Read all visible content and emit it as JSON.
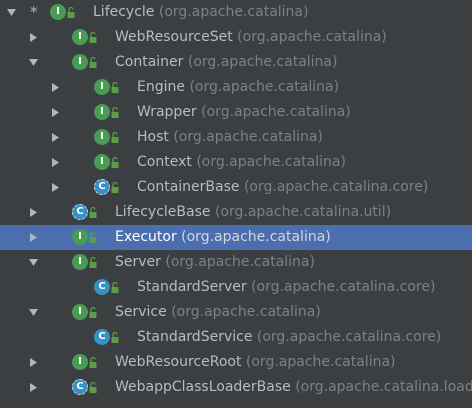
{
  "colors": {
    "background": "#3c3f41",
    "selection": "#4b6eaf",
    "interface_icon": "#499c54",
    "class_icon": "#3592c4",
    "visibility_lock": "#5a9e4a",
    "text": "#bbbbbb",
    "package_text": "#808080"
  },
  "tree": {
    "rows": [
      {
        "name": "Lifecycle",
        "package": "(org.apache.catalina)",
        "kind": "interface",
        "icon_letter": "I",
        "expanded": true,
        "root_marker": "*",
        "selected": false,
        "depth": 0,
        "icon": "interface-icon"
      },
      {
        "name": "WebResourceSet",
        "package": "(org.apache.catalina)",
        "kind": "interface",
        "icon_letter": "I",
        "expanded": false,
        "selected": false,
        "depth": 1,
        "icon": "interface-icon"
      },
      {
        "name": "Container",
        "package": "(org.apache.catalina)",
        "kind": "interface",
        "icon_letter": "I",
        "expanded": true,
        "selected": false,
        "depth": 1,
        "icon": "interface-icon"
      },
      {
        "name": "Engine",
        "package": "(org.apache.catalina)",
        "kind": "interface",
        "icon_letter": "I",
        "expanded": false,
        "selected": false,
        "depth": 2,
        "icon": "interface-icon"
      },
      {
        "name": "Wrapper",
        "package": "(org.apache.catalina)",
        "kind": "interface",
        "icon_letter": "I",
        "expanded": false,
        "selected": false,
        "depth": 2,
        "icon": "interface-icon"
      },
      {
        "name": "Host",
        "package": "(org.apache.catalina)",
        "kind": "interface",
        "icon_letter": "I",
        "expanded": false,
        "selected": false,
        "depth": 2,
        "icon": "interface-icon"
      },
      {
        "name": "Context",
        "package": "(org.apache.catalina)",
        "kind": "interface",
        "icon_letter": "I",
        "expanded": false,
        "selected": false,
        "depth": 2,
        "icon": "interface-icon"
      },
      {
        "name": "ContainerBase",
        "package": "(org.apache.catalina.core)",
        "kind": "abstract-class",
        "icon_letter": "C",
        "expanded": false,
        "selected": false,
        "depth": 2,
        "icon": "abstract-class-icon"
      },
      {
        "name": "LifecycleBase",
        "package": "(org.apache.catalina.util)",
        "kind": "abstract-class",
        "icon_letter": "C",
        "expanded": false,
        "selected": false,
        "depth": 1,
        "icon": "abstract-class-icon"
      },
      {
        "name": "Executor",
        "package": "(org.apache.catalina)",
        "kind": "interface",
        "icon_letter": "I",
        "expanded": false,
        "selected": true,
        "depth": 1,
        "icon": "interface-icon"
      },
      {
        "name": "Server",
        "package": "(org.apache.catalina)",
        "kind": "interface",
        "icon_letter": "I",
        "expanded": true,
        "selected": false,
        "depth": 1,
        "icon": "interface-icon"
      },
      {
        "name": "StandardServer",
        "package": "(org.apache.catalina.core)",
        "kind": "class",
        "icon_letter": "C",
        "leaf": true,
        "selected": false,
        "depth": 2,
        "icon": "class-icon"
      },
      {
        "name": "Service",
        "package": "(org.apache.catalina)",
        "kind": "interface",
        "icon_letter": "I",
        "expanded": true,
        "selected": false,
        "depth": 1,
        "icon": "interface-icon"
      },
      {
        "name": "StandardService",
        "package": "(org.apache.catalina.core)",
        "kind": "class",
        "icon_letter": "C",
        "leaf": true,
        "selected": false,
        "depth": 2,
        "icon": "class-icon"
      },
      {
        "name": "WebResourceRoot",
        "package": "(org.apache.catalina)",
        "kind": "interface",
        "icon_letter": "I",
        "expanded": false,
        "selected": false,
        "depth": 1,
        "icon": "interface-icon"
      },
      {
        "name": "WebappClassLoaderBase",
        "package": "(org.apache.catalina.loader)",
        "kind": "abstract-class",
        "icon_letter": "C",
        "expanded": false,
        "selected": false,
        "depth": 1,
        "icon": "abstract-class-icon"
      }
    ]
  }
}
